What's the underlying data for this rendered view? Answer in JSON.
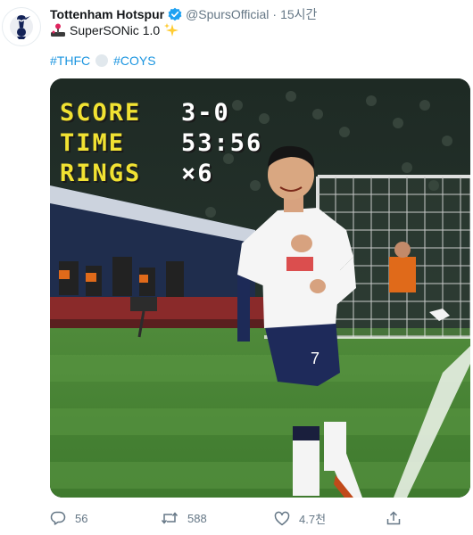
{
  "tweet": {
    "author_name": "Tottenham Hotspur",
    "handle": "@SpursOfficial",
    "separator": "·",
    "timestamp": "15시간",
    "text": "SuperSONic 1.0",
    "hashtags": [
      "#THFC",
      "#COYS"
    ]
  },
  "media": {
    "hud": [
      {
        "label": "SCORE",
        "value": "3-0"
      },
      {
        "label": "TIME",
        "value": "53:56"
      },
      {
        "label": "RINGS",
        "value": "×6"
      }
    ]
  },
  "actions": {
    "replies": "56",
    "retweets": "588",
    "likes": "4.7천"
  },
  "colors": {
    "link": "#1b95e0",
    "secondary_text": "#657786",
    "hud_label": "#f1e232",
    "verified": "#1da1f2"
  }
}
